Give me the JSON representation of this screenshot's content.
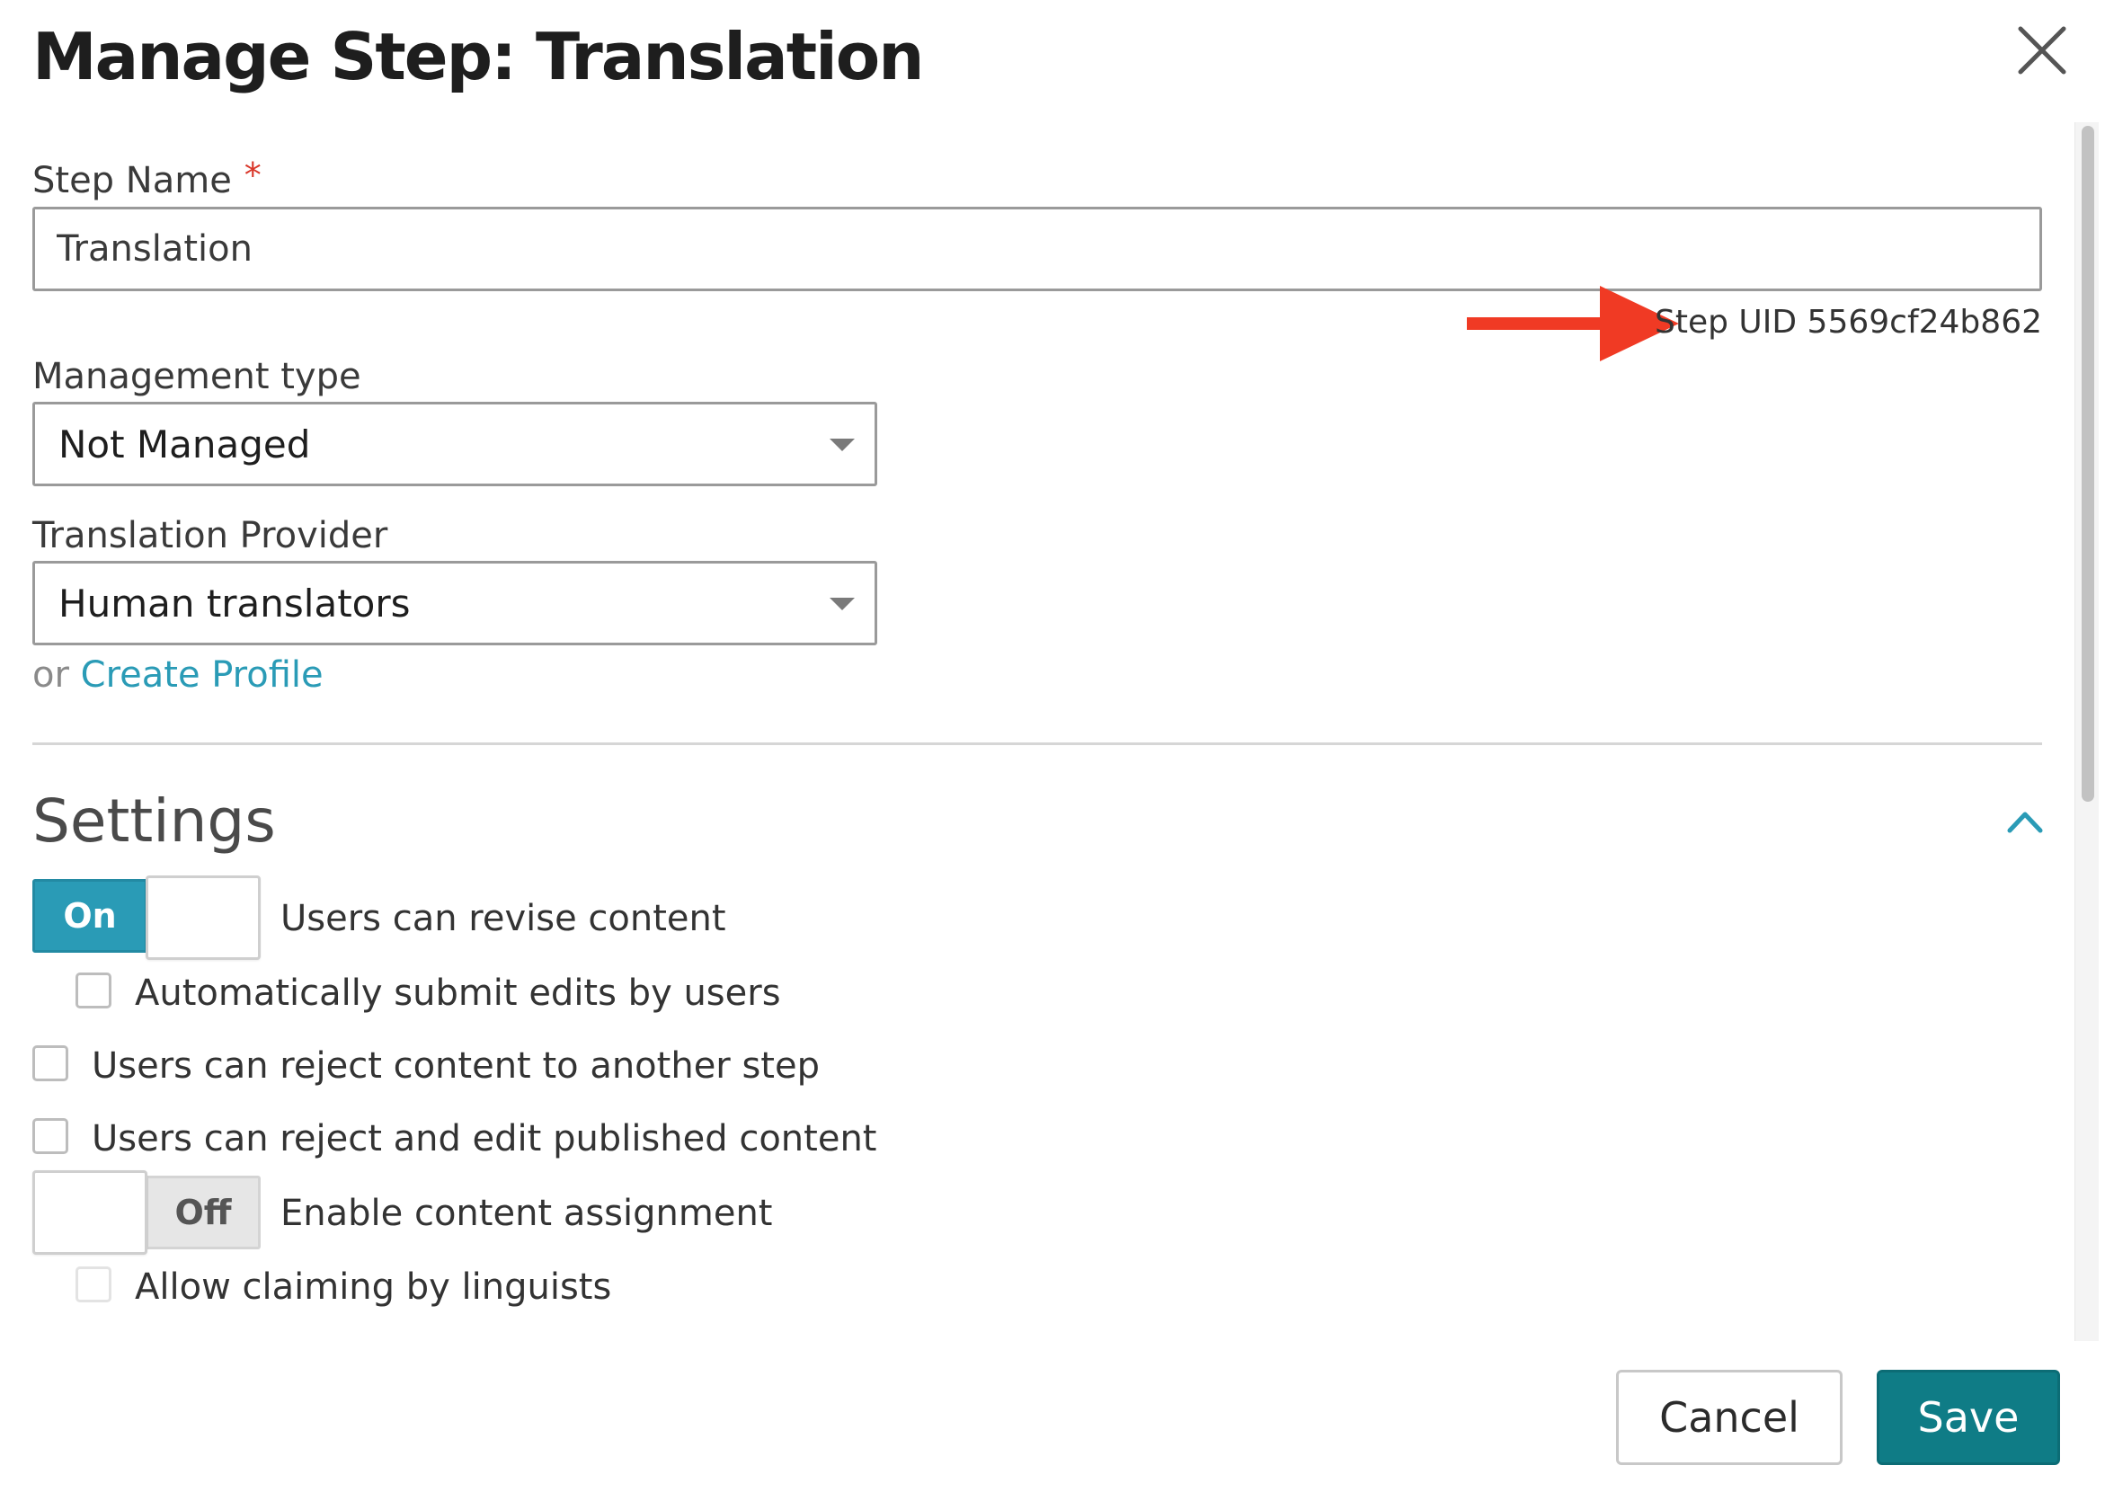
{
  "dialog": {
    "title": "Manage Step: Translation",
    "close_icon": "close-icon"
  },
  "step_name": {
    "label": "Step Name",
    "required_mark": "*",
    "value": "Translation",
    "uid_text": "Step UID 5569cf24b862",
    "arrow_color": "#f03a24"
  },
  "management_type": {
    "label": "Management type",
    "selected": "Not Managed"
  },
  "translation_provider": {
    "label": "Translation Provider",
    "selected": "Human translators",
    "or_text": "or",
    "create_profile_link": "Create Profile"
  },
  "settings": {
    "title": "Settings",
    "collapse_icon": "chevron-up-icon",
    "revise_toggle": {
      "state_label": "On",
      "label": "Users can revise content",
      "checked": true
    },
    "auto_submit": {
      "label": "Automatically submit edits by users",
      "checked": false
    },
    "reject_to_step": {
      "label": "Users can reject content to another step",
      "checked": false
    },
    "reject_edit_published": {
      "label": "Users can reject and edit published content",
      "checked": false
    },
    "assignment_toggle": {
      "state_label": "Off",
      "label": "Enable content assignment",
      "checked": false
    },
    "allow_claiming": {
      "label": "Allow claiming by linguists",
      "checked": false
    }
  },
  "footer": {
    "cancel_label": "Cancel",
    "save_label": "Save"
  },
  "colors": {
    "accent": "#2a9bb6",
    "primary_button": "#0f7c86",
    "required": "#d9372a"
  }
}
